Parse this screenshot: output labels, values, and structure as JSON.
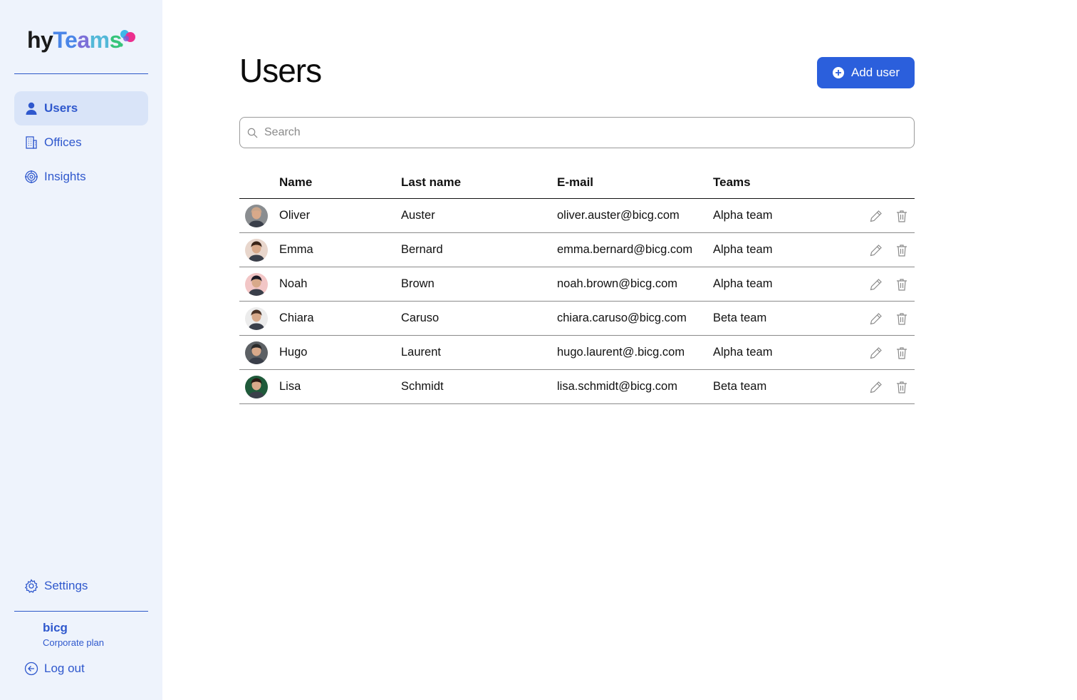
{
  "app": {
    "logo_hy": "hy",
    "logo_teams": "Teams",
    "logo_dot": "."
  },
  "sidebar": {
    "items": [
      {
        "label": "Users",
        "icon": "user-icon",
        "active": true
      },
      {
        "label": "Offices",
        "icon": "building-icon",
        "active": false
      },
      {
        "label": "Insights",
        "icon": "target-icon",
        "active": false
      }
    ],
    "settings_label": "Settings",
    "org_name": "bicg",
    "org_plan": "Corporate plan",
    "logout_label": "Log out"
  },
  "main": {
    "title": "Users",
    "add_button_label": "Add user",
    "search_placeholder": "Search",
    "columns": [
      "Name",
      "Last name",
      "E-mail",
      "Teams"
    ],
    "rows": [
      {
        "name": "Oliver",
        "last": "Auster",
        "email": "oliver.auster@bicg.com",
        "team": "Alpha team",
        "avatar_colors": [
          "#8a8d90",
          "#c9a58a"
        ]
      },
      {
        "name": "Emma",
        "last": "Bernard",
        "email": "emma.bernard@bicg.com",
        "team": "Alpha team",
        "avatar_colors": [
          "#e8d6cc",
          "#3a2418"
        ]
      },
      {
        "name": "Noah",
        "last": "Brown",
        "email": "noah.brown@bicg.com",
        "team": "Alpha team",
        "avatar_colors": [
          "#f2c6c6",
          "#1e1a24"
        ]
      },
      {
        "name": "Chiara",
        "last": "Caruso",
        "email": "chiara.caruso@bicg.com",
        "team": "Beta team",
        "avatar_colors": [
          "#ececec",
          "#4a3226"
        ]
      },
      {
        "name": "Hugo",
        "last": "Laurent",
        "email": "hugo.laurent@.bicg.com",
        "team": "Alpha team",
        "avatar_colors": [
          "#5c6064",
          "#2a2a2a"
        ]
      },
      {
        "name": "Lisa",
        "last": "Schmidt",
        "email": "lisa.schmidt@bicg.com",
        "team": "Beta team",
        "avatar_colors": [
          "#1f5a3a",
          "#2a1a14"
        ]
      }
    ]
  },
  "colors": {
    "accent": "#2b5fdc",
    "nav_text": "#2f58cd",
    "sidebar_bg": "#eef3fc",
    "active_bg": "#d9e4f8"
  }
}
